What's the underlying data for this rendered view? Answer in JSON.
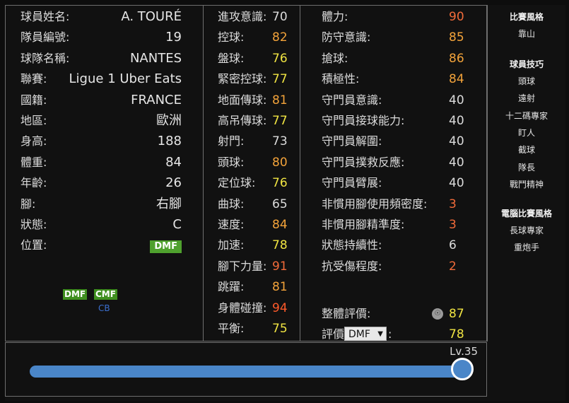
{
  "player": {
    "rows": [
      {
        "label": "球員姓名:",
        "value": "A. TOURÉ"
      },
      {
        "label": "隊員編號:",
        "value": "19"
      },
      {
        "label": "球隊名稱:",
        "value": "NANTES"
      },
      {
        "label": "聯賽:",
        "value": "Ligue 1 Uber Eats"
      },
      {
        "label": "國籍:",
        "value": "FRANCE"
      },
      {
        "label": "地區:",
        "value": "歐洲"
      },
      {
        "label": "身高:",
        "value": "188"
      },
      {
        "label": "體重:",
        "value": "84"
      },
      {
        "label": "年齡:",
        "value": "26"
      },
      {
        "label": "腳:",
        "value": "右腳"
      },
      {
        "label": "狀態:",
        "value": "C"
      }
    ],
    "position_label": "位置:",
    "position_value": "DMF",
    "mini_positions": {
      "chip1": "DMF",
      "chip2": "CMF",
      "sub": "CB"
    }
  },
  "stats_col1": [
    {
      "label": "進攻意識:",
      "value": "70",
      "color": "white"
    },
    {
      "label": "控球:",
      "value": "82",
      "color": "orange"
    },
    {
      "label": "盤球:",
      "value": "76",
      "color": "yellow"
    },
    {
      "label": "緊密控球:",
      "value": "77",
      "color": "yellow"
    },
    {
      "label": "地面傳球:",
      "value": "81",
      "color": "orange"
    },
    {
      "label": "高吊傳球:",
      "value": "77",
      "color": "yellow"
    },
    {
      "label": "射門:",
      "value": "73",
      "color": "white"
    },
    {
      "label": "頭球:",
      "value": "80",
      "color": "orange"
    },
    {
      "label": "定位球:",
      "value": "76",
      "color": "yellow"
    },
    {
      "label": "曲球:",
      "value": "65",
      "color": "white"
    },
    {
      "label": "速度:",
      "value": "84",
      "color": "orange"
    },
    {
      "label": "加速:",
      "value": "78",
      "color": "yellow"
    },
    {
      "label": "腳下力量:",
      "value": "91",
      "color": "red2"
    },
    {
      "label": "跳躍:",
      "value": "81",
      "color": "orange"
    },
    {
      "label": "身體碰撞:",
      "value": "94",
      "color": "red"
    },
    {
      "label": "平衡:",
      "value": "75",
      "color": "yellow"
    }
  ],
  "stats_col2": [
    {
      "label": "體力:",
      "value": "90",
      "color": "red2"
    },
    {
      "label": "防守意識:",
      "value": "85",
      "color": "orange"
    },
    {
      "label": "搶球:",
      "value": "86",
      "color": "orange"
    },
    {
      "label": "積極性:",
      "value": "84",
      "color": "orange"
    },
    {
      "label": "守門員意識:",
      "value": "40",
      "color": "white"
    },
    {
      "label": "守門員接球能力:",
      "value": "40",
      "color": "white"
    },
    {
      "label": "守門員解圍:",
      "value": "40",
      "color": "white"
    },
    {
      "label": "守門員撲救反應:",
      "value": "40",
      "color": "white"
    },
    {
      "label": "守門員臂展:",
      "value": "40",
      "color": "white"
    },
    {
      "label": "非慣用腳使用頻密度:",
      "value": "3",
      "color": "red2"
    },
    {
      "label": "非慣用腳精準度:",
      "value": "3",
      "color": "red2"
    },
    {
      "label": "狀態持續性:",
      "value": "6",
      "color": "white"
    },
    {
      "label": "抗受傷程度:",
      "value": "2",
      "color": "red2"
    }
  ],
  "overall": {
    "label": "整體評價:",
    "value": "87",
    "icon": "medal-icon"
  },
  "rating": {
    "label": "評價",
    "select_value": "DMF",
    "colon": ":",
    "value": "78"
  },
  "sidebar": {
    "style_title": "比賽風格",
    "style_value": "靠山",
    "skills_title": "球員技巧",
    "skills": [
      "頭球",
      "遠射",
      "十二碼專家",
      "盯人",
      "截球",
      "隊長",
      "戰鬥精神"
    ],
    "com_title": "電腦比賽風格",
    "com_styles": [
      "長球專家",
      "重炮手"
    ]
  },
  "level": {
    "label": "Lv.35",
    "fraction": 1.0
  },
  "colors": {
    "white": "#dcdcdc",
    "yellow": "#f0e442",
    "orange": "#f3a33a",
    "red": "#ff5a2a",
    "red2": "#f26b3a",
    "accent": "#4a86c8",
    "badge": "#4fa12e"
  }
}
